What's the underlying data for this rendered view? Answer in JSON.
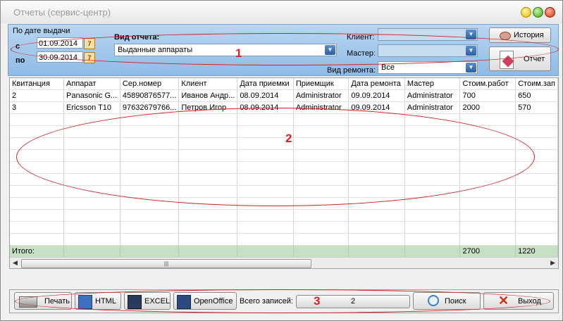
{
  "window": {
    "title": "Отчеты (сервис-центр)"
  },
  "filter": {
    "by_date_label": "По дате выдачи",
    "from_label": "с",
    "to_label": "по",
    "date_from": "01.09.2014",
    "date_to": "30.09.2014",
    "calendar_glyph": "7",
    "report_type_label": "Вид отчета:",
    "report_type_value": "Выданные аппараты",
    "client_label": "Клиент:",
    "master_label": "Мастер:",
    "repair_type_label": "Вид ремонта:",
    "repair_type_value": "Все",
    "history_button": "История",
    "report_button": "Отчет"
  },
  "table": {
    "columns": [
      "Квитанция",
      "Аппарат",
      "Сер.номер",
      "Клиент",
      "Дата приемки",
      "Приемщик",
      "Дата ремонта",
      "Мастер",
      "Стоим.работ",
      "Стоим.зап"
    ],
    "rows": [
      [
        "2",
        "Panasonic  G...",
        "45890876577...",
        "Иванов Андр...",
        "08.09.2014",
        "Administrator",
        "09.09.2014",
        "Administrator",
        "700",
        "650"
      ],
      [
        "3",
        "Ericsson  T10",
        "97632679766...",
        "Петров Игор",
        "08.09.2014",
        "Administrator",
        "09.09.2014",
        "Administrator",
        "2000",
        "570"
      ]
    ],
    "totals": [
      "Итого:",
      "",
      "",
      "",
      "",
      "",
      "",
      "",
      "2700",
      "1220"
    ]
  },
  "toolbar": {
    "print": "Печать",
    "html": "HTML",
    "excel": "EXCEL",
    "openoffice": "OpenOffice",
    "records_label": "Всего записей:",
    "records_count": "2",
    "search": "Поиск",
    "exit": "Выход"
  },
  "annotations": {
    "one": "1",
    "two": "2",
    "three": "3"
  },
  "colors": {
    "filter_panel": "#a7c8ec",
    "totals_row": "#c6e0c6",
    "annotation": "#d02020"
  }
}
